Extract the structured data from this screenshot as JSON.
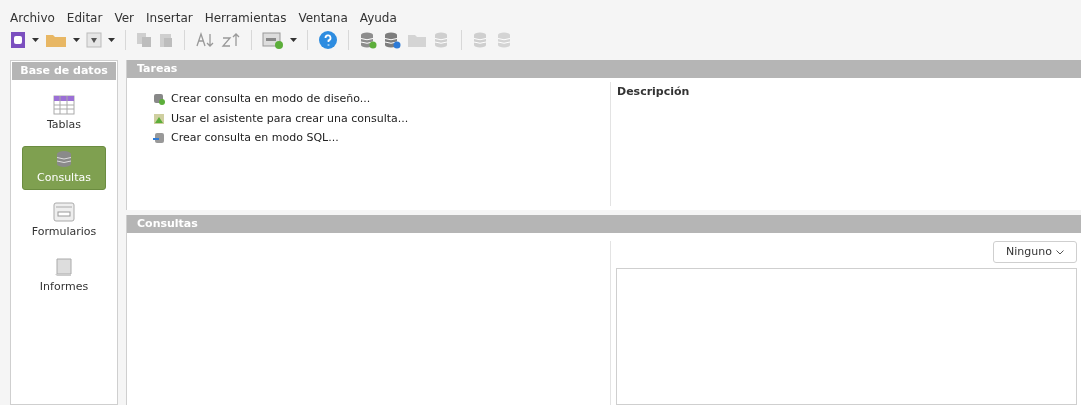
{
  "menu_bar": [
    "Archivo",
    "Editar",
    "Ver",
    "Insertar",
    "Herramientas",
    "Ventana",
    "Ayuda"
  ],
  "sidebar": {
    "title": "Base de datos",
    "items": [
      {
        "label": "Tablas",
        "kind": "table",
        "selected": false
      },
      {
        "label": "Consultas",
        "kind": "query",
        "selected": true
      },
      {
        "label": "Formularios",
        "kind": "form",
        "selected": false
      },
      {
        "label": "Informes",
        "kind": "report",
        "selected": false
      }
    ]
  },
  "tasks": {
    "title": "Tareas",
    "items": [
      {
        "label": "Crear consulta en modo de diseño...",
        "kind": "design"
      },
      {
        "label": "Usar el asistente para crear una consulta...",
        "kind": "wizard"
      },
      {
        "label": "Crear consulta en modo SQL...",
        "kind": "sql"
      }
    ],
    "description_title": "Descripción"
  },
  "queries": {
    "title": "Consultas",
    "preview_dropdown": "Ninguno"
  }
}
